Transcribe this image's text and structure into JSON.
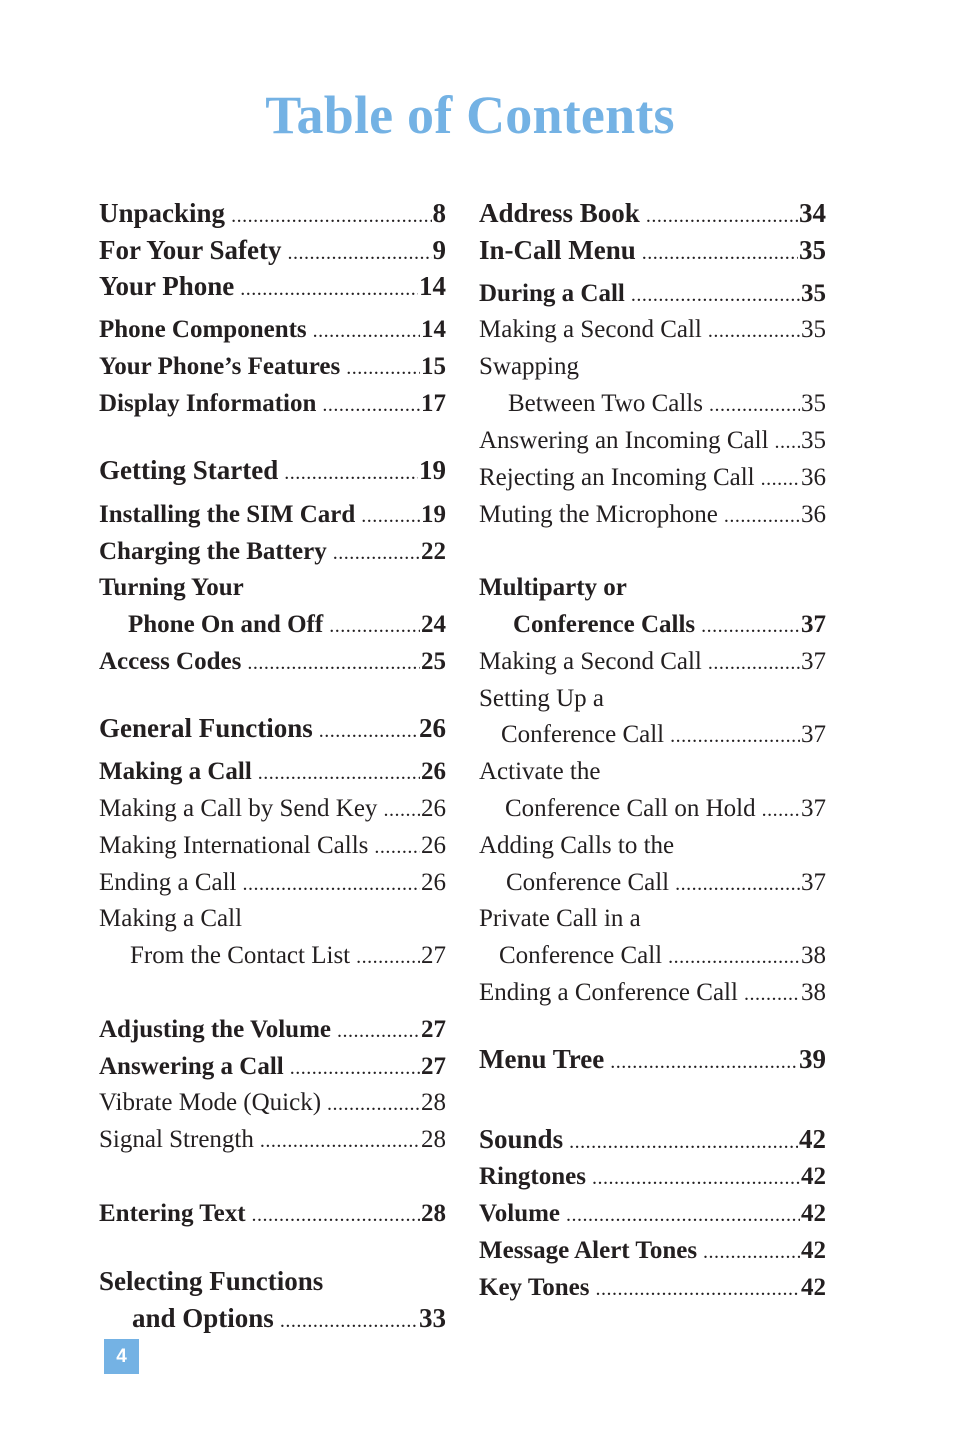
{
  "title": "Table of Contents",
  "page_number": "4",
  "accent_color": "#74b2e4",
  "left_column": [
    {
      "label": "Unpacking",
      "page": "8",
      "level": "major"
    },
    {
      "label": "For Your Safety",
      "page": "9",
      "level": "major"
    },
    {
      "label": "Your Phone",
      "page": "14",
      "level": "major"
    },
    {
      "label": "Phone Components",
      "page": "14",
      "level": "sub"
    },
    {
      "label": "Your Phone’s Features",
      "page": "15",
      "level": "sub"
    },
    {
      "label": "Display Information",
      "page": "17",
      "level": "sub"
    },
    {
      "label": "Getting Started",
      "page": "19",
      "level": "major"
    },
    {
      "label": "Installing the SIM Card",
      "page": "19",
      "level": "sub"
    },
    {
      "label": "Charging the Battery",
      "page": "22",
      "level": "sub"
    },
    {
      "label": "Turning Your",
      "page": "",
      "level": "sub"
    },
    {
      "label": "Phone On and Off",
      "page": "24",
      "level": "sub"
    },
    {
      "label": "Access Codes",
      "page": "25",
      "level": "sub"
    },
    {
      "label": "General Functions",
      "page": "26",
      "level": "major"
    },
    {
      "label": "Making a Call",
      "page": "26",
      "level": "sub"
    },
    {
      "label": "Making a Call by Send Key",
      "page": "26",
      "level": "plain"
    },
    {
      "label": "Making International Calls",
      "page": "26",
      "level": "plain"
    },
    {
      "label": "Ending a Call",
      "page": "26",
      "level": "plain"
    },
    {
      "label": "Making a Call",
      "page": "",
      "level": "plain"
    },
    {
      "label": "From the Contact List",
      "page": "27",
      "level": "plain"
    },
    {
      "label": "Adjusting the Volume",
      "page": "27",
      "level": "sub"
    },
    {
      "label": "Answering a Call",
      "page": "27",
      "level": "sub"
    },
    {
      "label": "Vibrate Mode (Quick)",
      "page": "28",
      "level": "plain"
    },
    {
      "label": "Signal Strength",
      "page": "28",
      "level": "plain"
    },
    {
      "label": "Entering Text",
      "page": "28",
      "level": "sub"
    },
    {
      "label": "Selecting Functions",
      "page": "",
      "level": "major"
    },
    {
      "label": "and Options",
      "page": "33",
      "level": "major"
    }
  ],
  "right_column": [
    {
      "label": "Address Book",
      "page": "34",
      "level": "major"
    },
    {
      "label": "In-Call Menu",
      "page": "35",
      "level": "major"
    },
    {
      "label": "During a Call",
      "page": "35",
      "level": "sub"
    },
    {
      "label": "Making a Second Call",
      "page": "35",
      "level": "plain"
    },
    {
      "label": "Swapping",
      "page": "",
      "level": "plain"
    },
    {
      "label": "Between Two Calls",
      "page": "35",
      "level": "plain"
    },
    {
      "label": "Answering an Incoming Call",
      "page": "35",
      "level": "plain"
    },
    {
      "label": "Rejecting an Incoming Call",
      "page": "36",
      "level": "plain"
    },
    {
      "label": "Muting the Microphone",
      "page": "36",
      "level": "plain"
    },
    {
      "label": "Multiparty or",
      "page": "",
      "level": "sub"
    },
    {
      "label": "Conference Calls",
      "page": "37",
      "level": "sub"
    },
    {
      "label": "Making a Second Call",
      "page": "37",
      "level": "plain"
    },
    {
      "label": "Setting Up a",
      "page": "",
      "level": "plain"
    },
    {
      "label": "Conference Call",
      "page": "37",
      "level": "plain"
    },
    {
      "label": "Activate the",
      "page": "",
      "level": "plain"
    },
    {
      "label": "Conference Call on Hold",
      "page": "37",
      "level": "plain"
    },
    {
      "label": "Adding Calls to the",
      "page": "",
      "level": "plain"
    },
    {
      "label": "Conference Call",
      "page": "37",
      "level": "plain"
    },
    {
      "label": "Private Call in a",
      "page": "",
      "level": "plain"
    },
    {
      "label": "Conference Call",
      "page": "38",
      "level": "plain"
    },
    {
      "label": "Ending a Conference Call",
      "page": "38",
      "level": "plain"
    },
    {
      "label": "Menu Tree",
      "page": "39",
      "level": "major"
    },
    {
      "label": "Sounds",
      "page": "42",
      "level": "major"
    },
    {
      "label": "Ringtones",
      "page": "42",
      "level": "sub"
    },
    {
      "label": "Volume",
      "page": "42",
      "level": "sub"
    },
    {
      "label": "Message Alert Tones",
      "page": "42",
      "level": "sub"
    },
    {
      "label": "Key Tones",
      "page": "42",
      "level": "sub"
    }
  ]
}
